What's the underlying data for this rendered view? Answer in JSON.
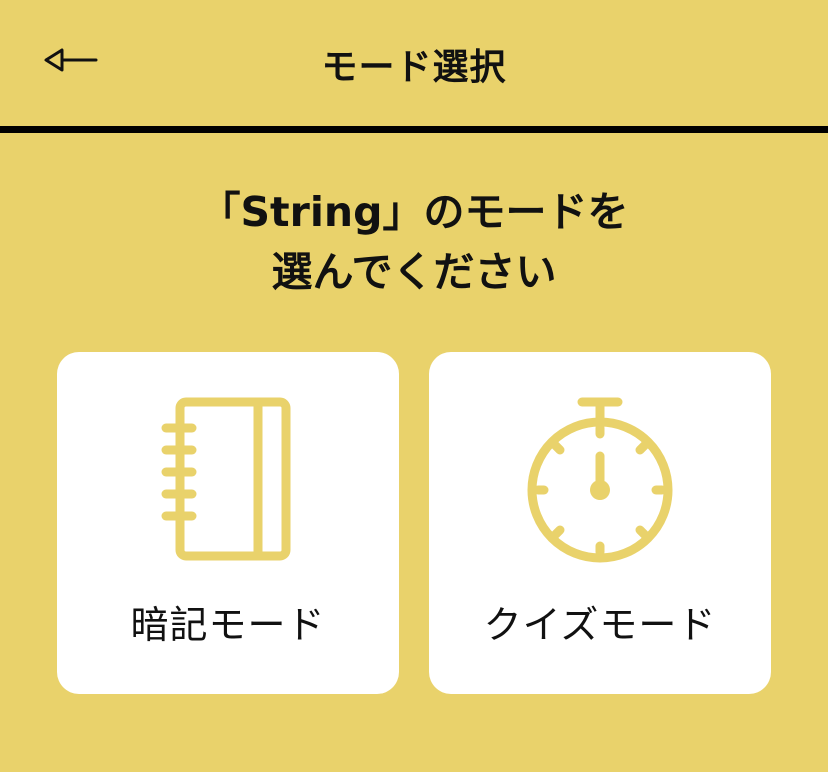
{
  "header": {
    "title": "モード選択",
    "back_icon": "back-arrow-icon"
  },
  "prompt": {
    "line1": "「String」のモードを",
    "line2": "選んでください"
  },
  "modes": [
    {
      "label": "暗記モード",
      "icon": "notebook-icon"
    },
    {
      "label": "クイズモード",
      "icon": "stopwatch-icon"
    }
  ],
  "colors": {
    "background": "#e9d26b",
    "accent": "#e9d26b",
    "card": "#ffffff",
    "text": "#111111"
  }
}
